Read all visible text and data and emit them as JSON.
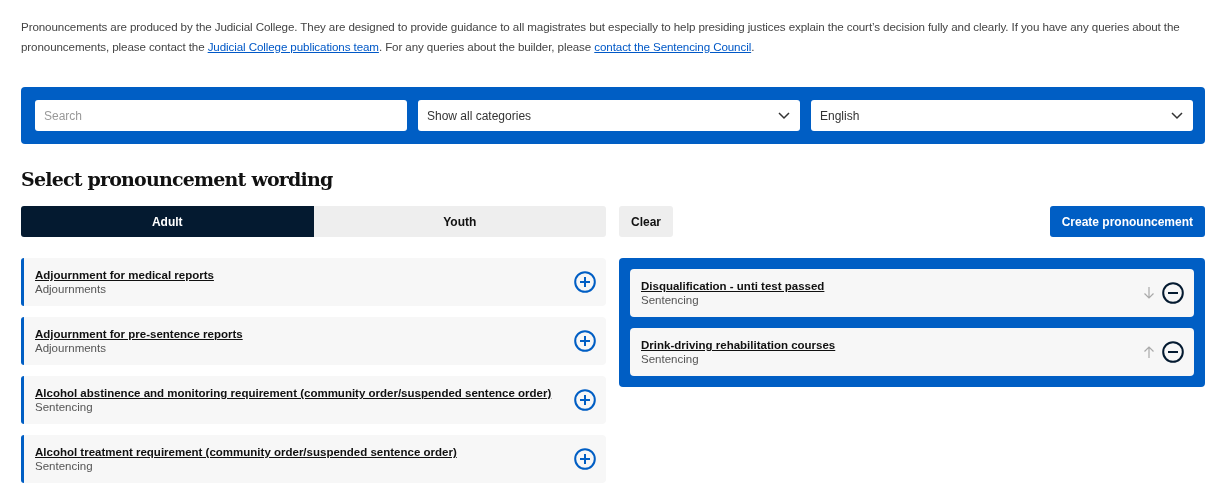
{
  "intro": [
    {
      "kind": "text",
      "text": "Pronouncements are produced by the Judicial College. They are designed to provide guidance to all magistrates but especially to help presiding justices explain the court’s decision fully and clearly. If you have any queries about the pronouncements, please contact the "
    },
    {
      "kind": "link",
      "text": "Judicial College publications team"
    },
    {
      "kind": "text",
      "text": ". For any queries about the builder, please "
    },
    {
      "kind": "link",
      "text": "contact the Sentencing Council"
    },
    {
      "kind": "text",
      "text": "."
    }
  ],
  "filters": {
    "search": {
      "placeholder": "Search"
    },
    "category": {
      "value": "Show all categories"
    },
    "language": {
      "value": "English"
    }
  },
  "heading": "Select pronouncement wording",
  "tabs": [
    {
      "label": "Adult",
      "selected": true
    },
    {
      "label": "Youth",
      "selected": false
    }
  ],
  "clear_button": "Clear",
  "create_button": "Create pronouncement",
  "available": [
    {
      "title": "Adjournment for medical reports",
      "category": "Adjournments"
    },
    {
      "title": "Adjournment for pre-sentence reports",
      "category": "Adjournments"
    },
    {
      "title": "Alcohol abstinence and monitoring requirement (community order/suspended sentence order)",
      "category": "Sentencing"
    },
    {
      "title": "Alcohol treatment requirement (community order/suspended sentence order)",
      "category": "Sentencing"
    }
  ],
  "selected_items": [
    {
      "title": "Disqualification - unti test passed",
      "category": "Sentencing",
      "kind": "move-down"
    },
    {
      "title": "Drink-driving rehabilitation courses",
      "category": "Sentencing",
      "kind": "move-up"
    }
  ]
}
